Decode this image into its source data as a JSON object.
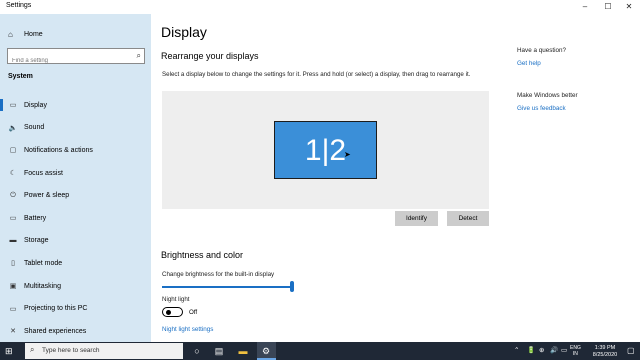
{
  "window": {
    "title": "Settings",
    "controls": [
      "–",
      "☐",
      "✕"
    ]
  },
  "sidebar": {
    "home_label": "Home",
    "search_placeholder": "Find a setting",
    "section_label": "System",
    "items": [
      {
        "label": "Display",
        "icon": "monitor-icon",
        "glyph": "▭",
        "active": true
      },
      {
        "label": "Sound",
        "icon": "speaker-icon",
        "glyph": "🔈",
        "active": false
      },
      {
        "label": "Notifications & actions",
        "icon": "notification-icon",
        "glyph": "▢",
        "active": false
      },
      {
        "label": "Focus assist",
        "icon": "moon-icon",
        "glyph": "☾",
        "active": false
      },
      {
        "label": "Power & sleep",
        "icon": "power-icon",
        "glyph": "⏻",
        "active": false
      },
      {
        "label": "Battery",
        "icon": "battery-icon",
        "glyph": "▭",
        "active": false
      },
      {
        "label": "Storage",
        "icon": "storage-icon",
        "glyph": "▬",
        "active": false
      },
      {
        "label": "Tablet mode",
        "icon": "tablet-icon",
        "glyph": "▯",
        "active": false
      },
      {
        "label": "Multitasking",
        "icon": "multitask-icon",
        "glyph": "▣",
        "active": false
      },
      {
        "label": "Projecting to this PC",
        "icon": "project-icon",
        "glyph": "▭",
        "active": false
      },
      {
        "label": "Shared experiences",
        "icon": "share-icon",
        "glyph": "✕",
        "active": false
      }
    ]
  },
  "main": {
    "title": "Display",
    "rearrange_heading": "Rearrange your displays",
    "rearrange_instructions": "Select a display below to change the settings for it. Press and hold (or select) a display, then drag to rearrange it.",
    "monitor_label": "1|2",
    "identify_label": "Identify",
    "detect_label": "Detect",
    "brightness_heading": "Brightness and color",
    "brightness_label": "Change brightness for the built-in display",
    "brightness_value": 1.0,
    "night_light_label": "Night light",
    "night_light_state": "Off",
    "night_light_settings": "Night light settings"
  },
  "right_panel": {
    "question_heading": "Have a question?",
    "help_link": "Get help",
    "better_heading": "Make Windows better",
    "feedback_link": "Give us feedback"
  },
  "taskbar": {
    "search_placeholder": "Type here to search",
    "pinned": [
      "cortana-icon",
      "task-view-icon",
      "file-explorer-icon",
      "settings-icon"
    ],
    "tray_glyphs": [
      "⌃",
      "🔋",
      "⊕",
      "🔊",
      "▭"
    ],
    "language": [
      "ENG",
      "IN"
    ],
    "time": "1:39 PM",
    "date": "8/25/2020"
  },
  "colors": {
    "accent": "#1a6fc4",
    "sidebar_bg": "#d6e7f3",
    "monitor_fill": "#3b8fd8",
    "taskbar_bg": "#1f2836"
  }
}
